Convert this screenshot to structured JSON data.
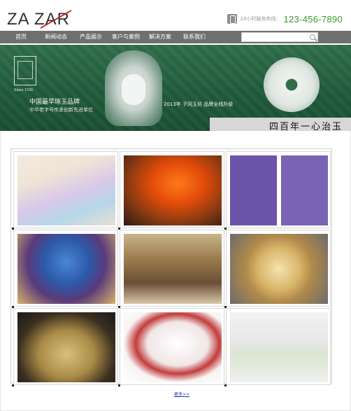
{
  "brand": {
    "logo_text": "ZA ZAR"
  },
  "contact": {
    "hotline_label": "24小时服务热线：",
    "hotline_number": "123-456-7890"
  },
  "nav": {
    "items": [
      {
        "label": "首页"
      },
      {
        "label": "新闻动态"
      },
      {
        "label": "产品展示"
      },
      {
        "label": "客户与案例"
      },
      {
        "label": "解决方案"
      },
      {
        "label": "联系我们"
      }
    ],
    "search": {
      "placeholder": ""
    }
  },
  "banner": {
    "since": "Since 1539",
    "slogan_main": "中国最早琢玉品牌",
    "slogan_sub": "中华老字号传承创新先进单位",
    "promo": "2013年 子冈玉坊 品牌全线升级",
    "calligraphy": "四百年一心治玉"
  },
  "products": {
    "items": [
      {
        "icon": "whale-artwork-image"
      },
      {
        "icon": "amber-gourd-carving-image"
      },
      {
        "icon": "flower-bouquets-image"
      },
      {
        "icon": "doraemon-figure-image"
      },
      {
        "icon": "baskets-stall-image"
      },
      {
        "icon": "sunflower-wood-panel-image"
      },
      {
        "icon": "bamboo-lamps-image"
      },
      {
        "icon": "ceramic-teaset-image"
      },
      {
        "icon": "clay-dolls-image"
      }
    ],
    "more_label": "更多>>"
  }
}
